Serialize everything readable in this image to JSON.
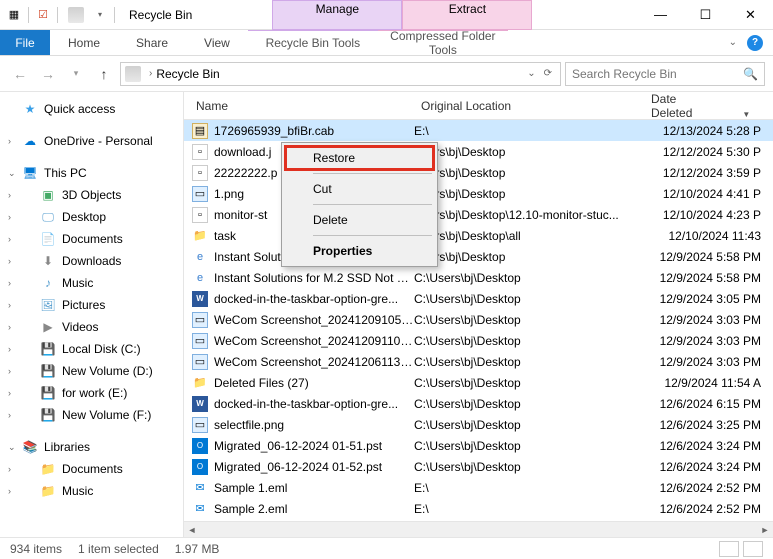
{
  "window": {
    "title": "Recycle Bin"
  },
  "tab_contexts": {
    "manage": "Manage",
    "extract": "Extract"
  },
  "ribbon": {
    "file": "File",
    "home": "Home",
    "share": "Share",
    "view": "View",
    "sub_manage": "Recycle Bin Tools",
    "sub_extract": "Compressed Folder Tools"
  },
  "address": {
    "location": "Recycle Bin"
  },
  "search": {
    "placeholder": "Search Recycle Bin"
  },
  "sidebar": {
    "quick": "Quick access",
    "onedrive": "OneDrive - Personal",
    "thispc": "This PC",
    "items": [
      "3D Objects",
      "Desktop",
      "Documents",
      "Downloads",
      "Music",
      "Pictures",
      "Videos",
      "Local Disk (C:)",
      "New Volume (D:)",
      "for work (E:)",
      "New Volume (F:)"
    ],
    "libraries": "Libraries",
    "lib_items": [
      "Documents",
      "Music"
    ]
  },
  "columns": {
    "name": "Name",
    "loc": "Original Location",
    "date": "Date Deleted"
  },
  "files": [
    {
      "ico": "cab",
      "name": "1726965939_bfiBr.cab",
      "loc": "E:\\",
      "date": "12/13/2024 5:28 P",
      "sel": true
    },
    {
      "ico": "generic",
      "name": "download.j",
      "loc": "Users\\bj\\Desktop",
      "date": "12/12/2024 5:30 P"
    },
    {
      "ico": "generic",
      "name": "22222222.p",
      "loc": "Users\\bj\\Desktop",
      "date": "12/12/2024 3:59 P"
    },
    {
      "ico": "png",
      "name": "1.png",
      "loc": "Users\\bj\\Desktop",
      "date": "12/10/2024 4:41 P"
    },
    {
      "ico": "generic",
      "name": "monitor-st",
      "loc": "Users\\bj\\Desktop\\12.10-monitor-stuc...",
      "date": "12/10/2024 4:23 P"
    },
    {
      "ico": "folder",
      "name": "task",
      "loc": "Users\\bj\\Desktop\\all",
      "date": "12/10/2024 11:43"
    },
    {
      "ico": "ie",
      "name": "Instant Solutions for ... ",
      "loc": "Users\\bj\\Desktop",
      "date": "12/9/2024 5:58 PM"
    },
    {
      "ico": "ie",
      "name": "Instant Solutions for M.2 SSD Not S...",
      "loc": "C:\\Users\\bj\\Desktop",
      "date": "12/9/2024 5:58 PM"
    },
    {
      "ico": "word",
      "name": "docked-in-the-taskbar-option-gre...",
      "loc": "C:\\Users\\bj\\Desktop",
      "date": "12/9/2024 3:05 PM"
    },
    {
      "ico": "png",
      "name": "WeCom Screenshot_202412091059...",
      "loc": "C:\\Users\\bj\\Desktop",
      "date": "12/9/2024 3:03 PM"
    },
    {
      "ico": "png",
      "name": "WeCom Screenshot_202412091100...",
      "loc": "C:\\Users\\bj\\Desktop",
      "date": "12/9/2024 3:03 PM"
    },
    {
      "ico": "png",
      "name": "WeCom Screenshot_202412061139...",
      "loc": "C:\\Users\\bj\\Desktop",
      "date": "12/9/2024 3:03 PM"
    },
    {
      "ico": "folder",
      "name": "Deleted Files (27)",
      "loc": "C:\\Users\\bj\\Desktop",
      "date": "12/9/2024 11:54 A"
    },
    {
      "ico": "word",
      "name": "docked-in-the-taskbar-option-gre...",
      "loc": "C:\\Users\\bj\\Desktop",
      "date": "12/6/2024 6:15 PM"
    },
    {
      "ico": "png",
      "name": "selectfile.png",
      "loc": "C:\\Users\\bj\\Desktop",
      "date": "12/6/2024 3:25 PM"
    },
    {
      "ico": "pst",
      "name": "Migrated_06-12-2024 01-51.pst",
      "loc": "C:\\Users\\bj\\Desktop",
      "date": "12/6/2024 3:24 PM"
    },
    {
      "ico": "pst",
      "name": "Migrated_06-12-2024 01-52.pst",
      "loc": "C:\\Users\\bj\\Desktop",
      "date": "12/6/2024 3:24 PM"
    },
    {
      "ico": "eml",
      "name": "Sample 1.eml",
      "loc": "E:\\",
      "date": "12/6/2024 2:52 PM"
    },
    {
      "ico": "eml",
      "name": "Sample 2.eml",
      "loc": "E:\\",
      "date": "12/6/2024 2:52 PM"
    }
  ],
  "context_menu": {
    "restore": "Restore",
    "cut": "Cut",
    "delete": "Delete",
    "properties": "Properties"
  },
  "status": {
    "count": "934 items",
    "sel": "1 item selected",
    "size": "1.97 MB"
  }
}
